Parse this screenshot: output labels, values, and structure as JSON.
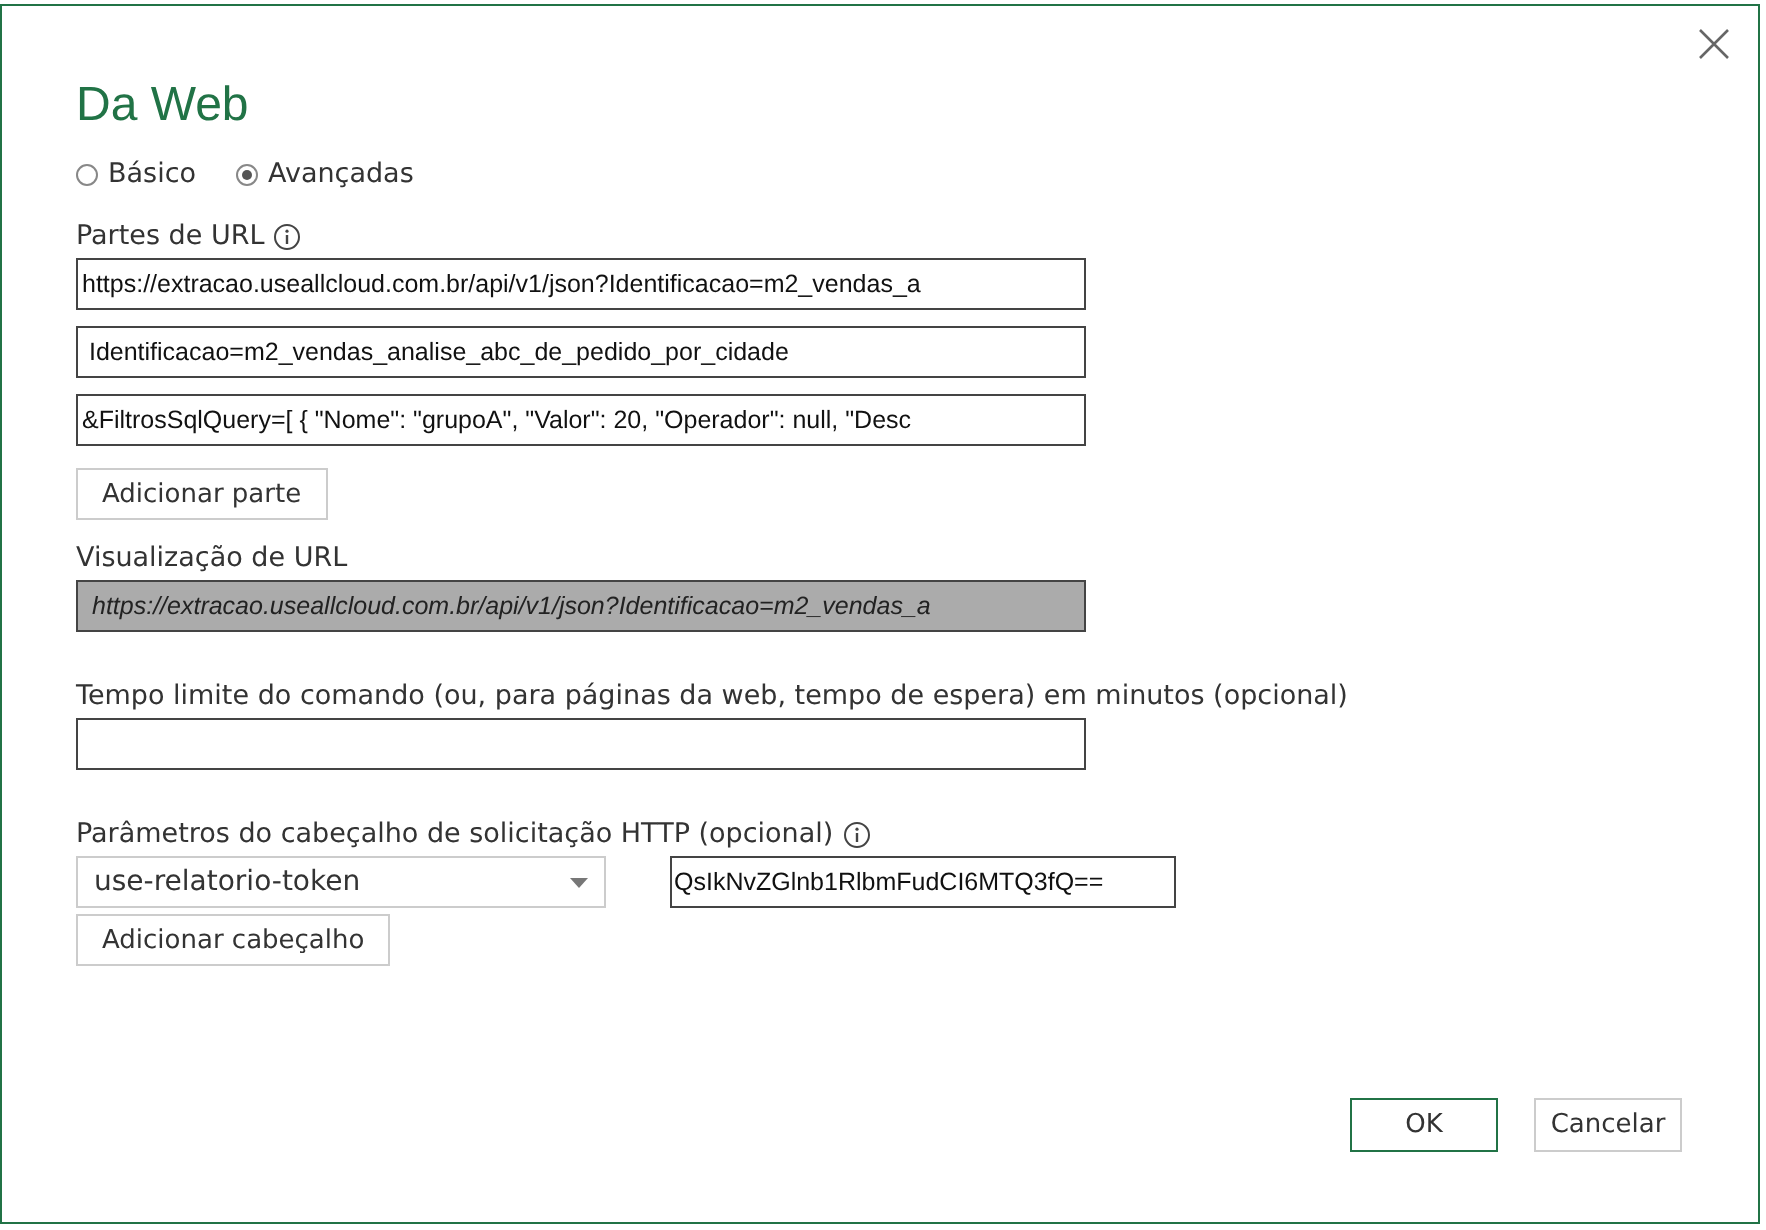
{
  "dialog": {
    "title": "Da Web"
  },
  "modes": [
    {
      "label": "Básico",
      "selected": false
    },
    {
      "label": "Avançadas",
      "selected": true
    }
  ],
  "url_parts": {
    "label": "Partes de URL",
    "values": [
      "https://extracao.useallcloud.com.br/api/v1/json?Identificacao=m2_vendas_a",
      " Identificacao=m2_vendas_analise_abc_de_pedido_por_cidade",
      "&FiltrosSqlQuery=[ { \"Nome\": \"grupoA\", \"Valor\": 20, \"Operador\": null, \"Desc"
    ],
    "add_button": "Adicionar parte"
  },
  "url_preview": {
    "label": "Visualização de URL",
    "value": "https://extracao.useallcloud.com.br/api/v1/json?Identificacao=m2_vendas_a"
  },
  "timeout": {
    "label": "Tempo limite do comando (ou, para páginas da web, tempo de espera) em minutos (opcional)"
  },
  "headers": {
    "label": "Parâmetros do cabeçalho de solicitação HTTP (opcional)",
    "name": "use-relatorio-token",
    "value": "QsIkNvZGlnb1RlbmFudCI6MTQ3fQ==",
    "add_button": "Adicionar cabeçalho"
  },
  "buttons": [
    "OK",
    "Cancelar"
  ]
}
